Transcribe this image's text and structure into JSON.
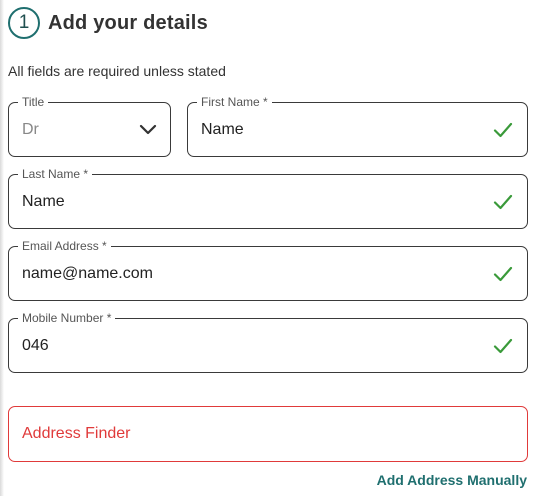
{
  "step": {
    "number": "1",
    "title": "Add your details"
  },
  "note": "All fields are required unless stated",
  "fields": {
    "title": {
      "label": "Title",
      "value": "Dr",
      "icon": "chevron-down-icon"
    },
    "first_name": {
      "label": "First Name *",
      "value": "Name",
      "valid": true
    },
    "last_name": {
      "label": "Last Name *",
      "value": "Name",
      "valid": true
    },
    "email": {
      "label": "Email Address *",
      "value": "name@name.com",
      "valid": true
    },
    "mobile": {
      "label": "Mobile Number *",
      "value": "046",
      "valid": true
    },
    "address_finder": {
      "placeholder": "Address Finder",
      "state": "error"
    }
  },
  "add_address_manually": "Add Address Manually",
  "colors": {
    "accent": "#1f6f6f",
    "valid": "#3a9a3a",
    "error": "#e03a3a",
    "border": "#3a3a3a"
  }
}
